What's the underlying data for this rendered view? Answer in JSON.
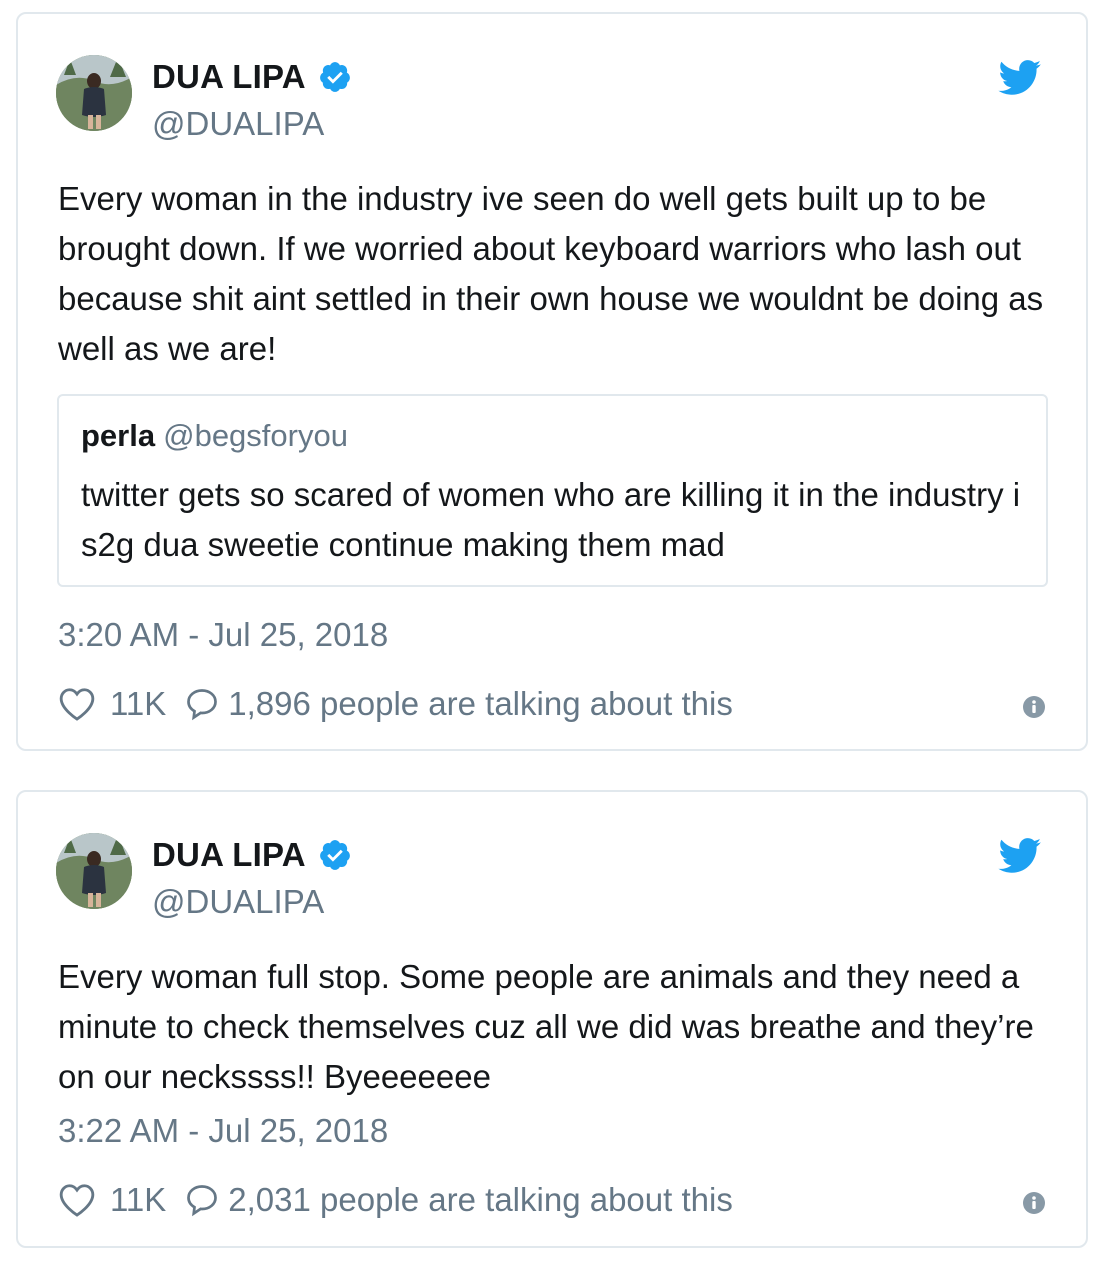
{
  "tweets": [
    {
      "author": {
        "name": "DUA LIPA",
        "handle": "@DUALIPA"
      },
      "text": "Every woman in the industry ive seen do well gets built up to be brought down. If we worried about keyboard warriors who lash out because shit aint settled in their own house we wouldnt be doing as well as we are!",
      "quote": {
        "name": "perla",
        "handle": "@begsforyou",
        "text": "twitter gets so scared of women who are killing it in the industry i s2g dua sweetie continue making them mad"
      },
      "timestamp": "3:20 AM - Jul 25, 2018",
      "likes": "11K",
      "talking": "1,896 people are talking about this"
    },
    {
      "author": {
        "name": "DUA LIPA",
        "handle": "@DUALIPA"
      },
      "text": "Every woman full stop. Some people are animals and they need a minute to check themselves cuz all we did was breathe and they’re on our neckssss!! Byeeeeeee",
      "timestamp": "3:22 AM - Jul 25, 2018",
      "likes": "11K",
      "talking": "2,031 people are talking about this"
    }
  ],
  "colors": {
    "verified_blue": "#1da1f2",
    "secondary_text": "#657786",
    "border": "#e1e8ed"
  },
  "icons": [
    "verified-badge-icon",
    "twitter-bird-icon",
    "heart-icon",
    "reply-bubble-icon",
    "info-icon"
  ]
}
